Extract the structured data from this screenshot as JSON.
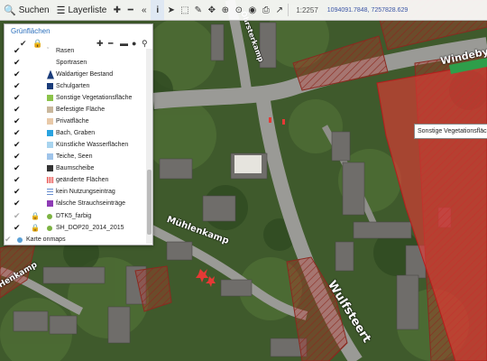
{
  "toolbar": {
    "search_label": "Suchen",
    "layers_label": "Layerliste",
    "scale": "1:2257",
    "coords": "1094091.7848, 7257828.629"
  },
  "panel": {
    "title": "Grünflächen",
    "items": [
      {
        "label": "Rasen",
        "checked": true
      },
      {
        "label": "Sportrasen",
        "checked": true
      },
      {
        "label": "Waldartiger Bestand",
        "checked": true,
        "symbol": "forest"
      },
      {
        "label": "Schulgarten",
        "checked": true,
        "symbol": "school"
      },
      {
        "label": "Sonstige Vegetationsfläche",
        "checked": true,
        "color": "#8bc34a"
      },
      {
        "label": "Befestigte Fläche",
        "checked": true,
        "color": "#c9b79c"
      },
      {
        "label": "Privatfläche",
        "checked": true,
        "color": "#e8c9a8"
      },
      {
        "label": "Bach, Graben",
        "checked": true,
        "color": "#29a3e0"
      },
      {
        "label": "Künstliche Wasserflächen",
        "checked": true,
        "color": "#a8d4ef"
      },
      {
        "label": "Teiche, Seen",
        "checked": true,
        "color": "#9fc4ea"
      },
      {
        "label": "Baumscheibe",
        "checked": true,
        "color": "#333333"
      },
      {
        "label": "geänderte Flächen",
        "checked": true,
        "symbol": "hatch-red"
      },
      {
        "label": "kein Nutzungseintrag",
        "checked": true,
        "symbol": "lines-blue"
      },
      {
        "label": "falsche Strauchseinträge",
        "checked": true,
        "color": "#8e3bb5"
      },
      {
        "label": "DTK5_farbig",
        "checked": false,
        "dot": "#7cb342",
        "lock": true
      },
      {
        "label": "SH_DOP20_2014_2015",
        "checked": true,
        "dot": "#7cb342",
        "lock": true
      },
      {
        "label": "Karte onmaps",
        "checked": false,
        "dot": "#5aa0d6"
      }
    ]
  },
  "map": {
    "street_labels": [
      "Windeby",
      "Wulfsteert",
      "Mühlenkamp",
      "Henkamp",
      "Öhrsterkamp"
    ],
    "tooltip": "Sonstige Vegetationsfläche"
  },
  "colors": {
    "accent": "#2a6ebb",
    "changed_area": "#e53935"
  }
}
